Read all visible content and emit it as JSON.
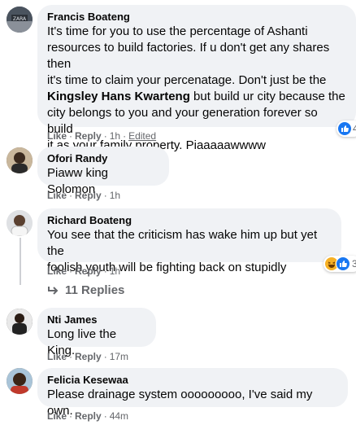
{
  "comments": [
    {
      "name": "Francis Boateng",
      "text_lines": [
        "It's time for you to use the percentage of Ashanti",
        "resources to build factories. If u don't get any shares then",
        "it's time to claim your percenatage. Don't just be the"
      ],
      "mention": "Kingsley Hans Kwarteng",
      "mention_after": " but build ur city because the",
      "text_lines_2": [
        "city belongs to you and your generation forever so build",
        "it as your family property. Piaaaaawwww"
      ],
      "like": "Like",
      "reply": "Reply",
      "time": "1h",
      "edited": "Edited",
      "reaction_count": "4"
    },
    {
      "name": "Ofori Randy",
      "text": "Piaww king Solomon",
      "like": "Like",
      "reply": "Reply",
      "time": "1h"
    },
    {
      "name": "Richard Boateng",
      "text_lines": [
        "You see that the criticism has wake him up but yet the",
        "foolish youth will be fighting back on stupidly"
      ],
      "like": "Like",
      "reply": "Reply",
      "time": "1h",
      "reaction_count": "3",
      "replies": "11 Replies"
    },
    {
      "name": "Nti James",
      "text": "Long live the King.",
      "like": "Like",
      "reply": "Reply",
      "time": "17m"
    },
    {
      "name": "Felicia Kesewaa",
      "text": "Please drainage system ooooooooo, I've said my own.",
      "like": "Like",
      "reply": "Reply",
      "time": "44m"
    }
  ],
  "colors": {
    "bubble": "#f0f2f5",
    "like_blue": "#1877f2",
    "muted": "#65676b"
  }
}
